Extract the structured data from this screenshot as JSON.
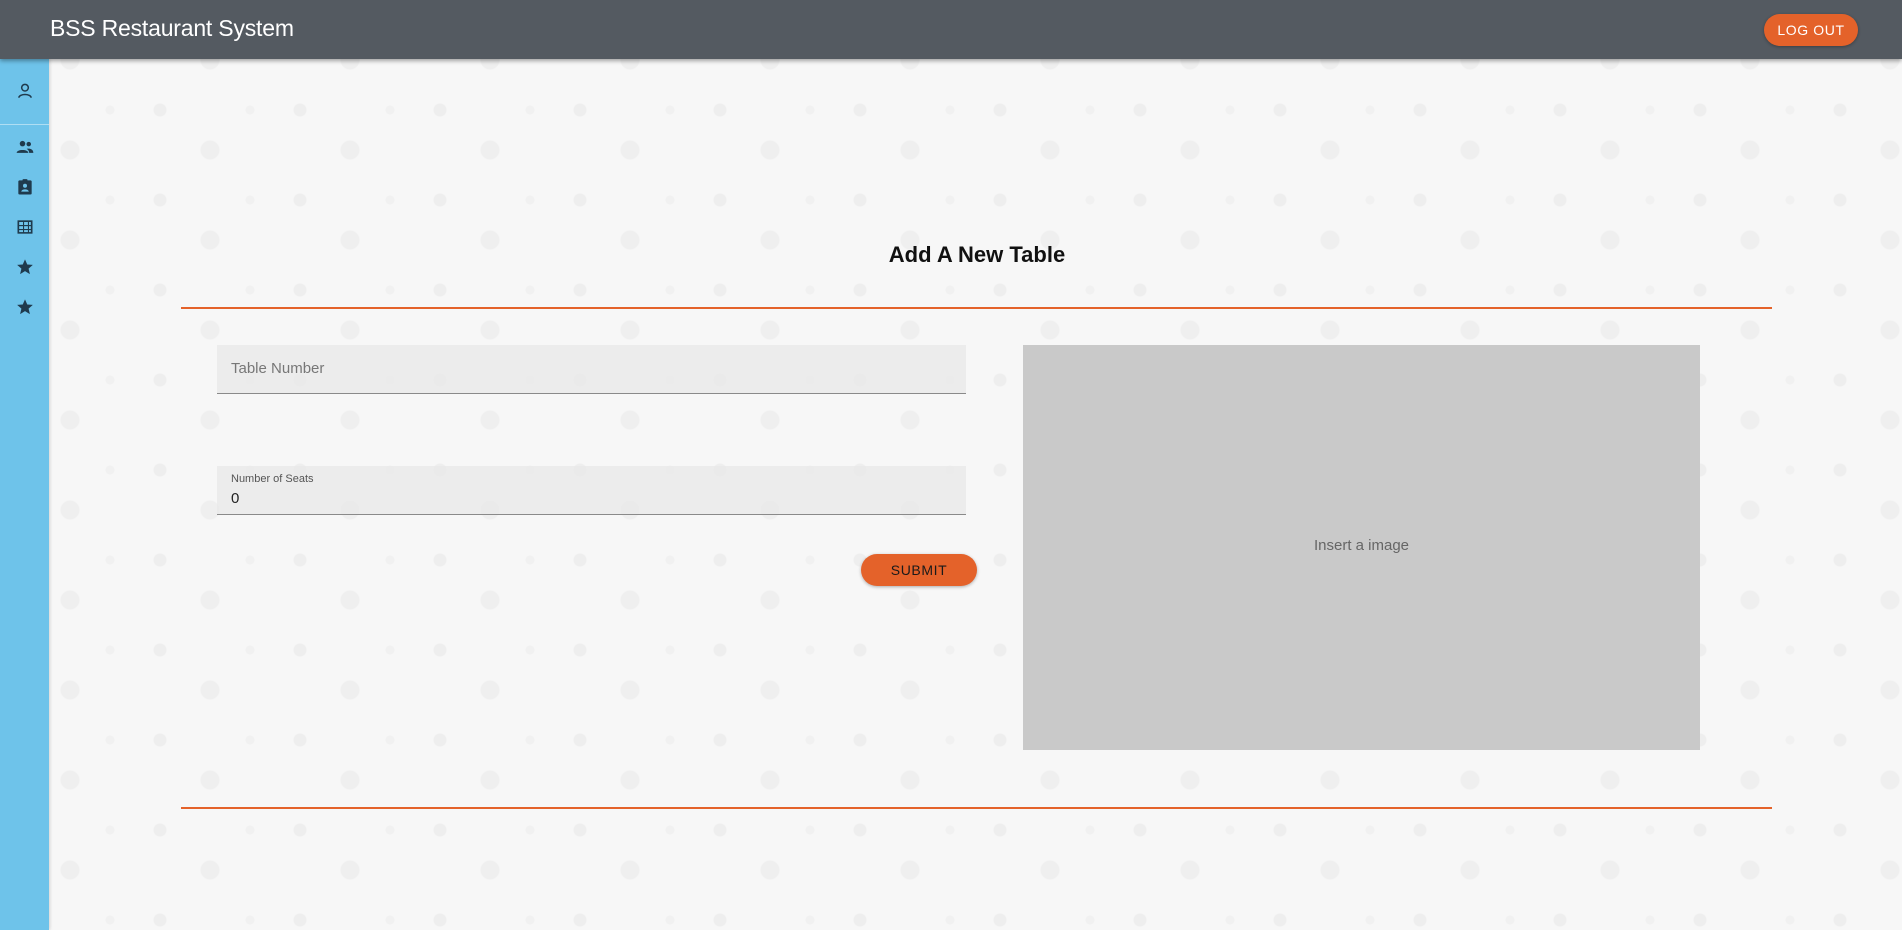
{
  "header": {
    "title": "BSS Restaurant System",
    "logout_label": "LOG OUT",
    "bar_color": "#545a61",
    "accent_color": "#e4622a"
  },
  "sidebar": {
    "background_color": "#6ec3ea",
    "items": [
      {
        "icon": "person-outline-icon"
      },
      {
        "icon": "people-icon"
      },
      {
        "icon": "badge-clipboard-icon"
      },
      {
        "icon": "table-grid-icon"
      },
      {
        "icon": "star-icon"
      },
      {
        "icon": "star-icon"
      }
    ]
  },
  "main": {
    "heading": "Add A New Table",
    "table_number": {
      "placeholder": "Table Number",
      "value": ""
    },
    "seats": {
      "label": "Number of Seats",
      "value": "0"
    },
    "submit_label": "SUBMIT",
    "image_placeholder": "Insert a image"
  }
}
